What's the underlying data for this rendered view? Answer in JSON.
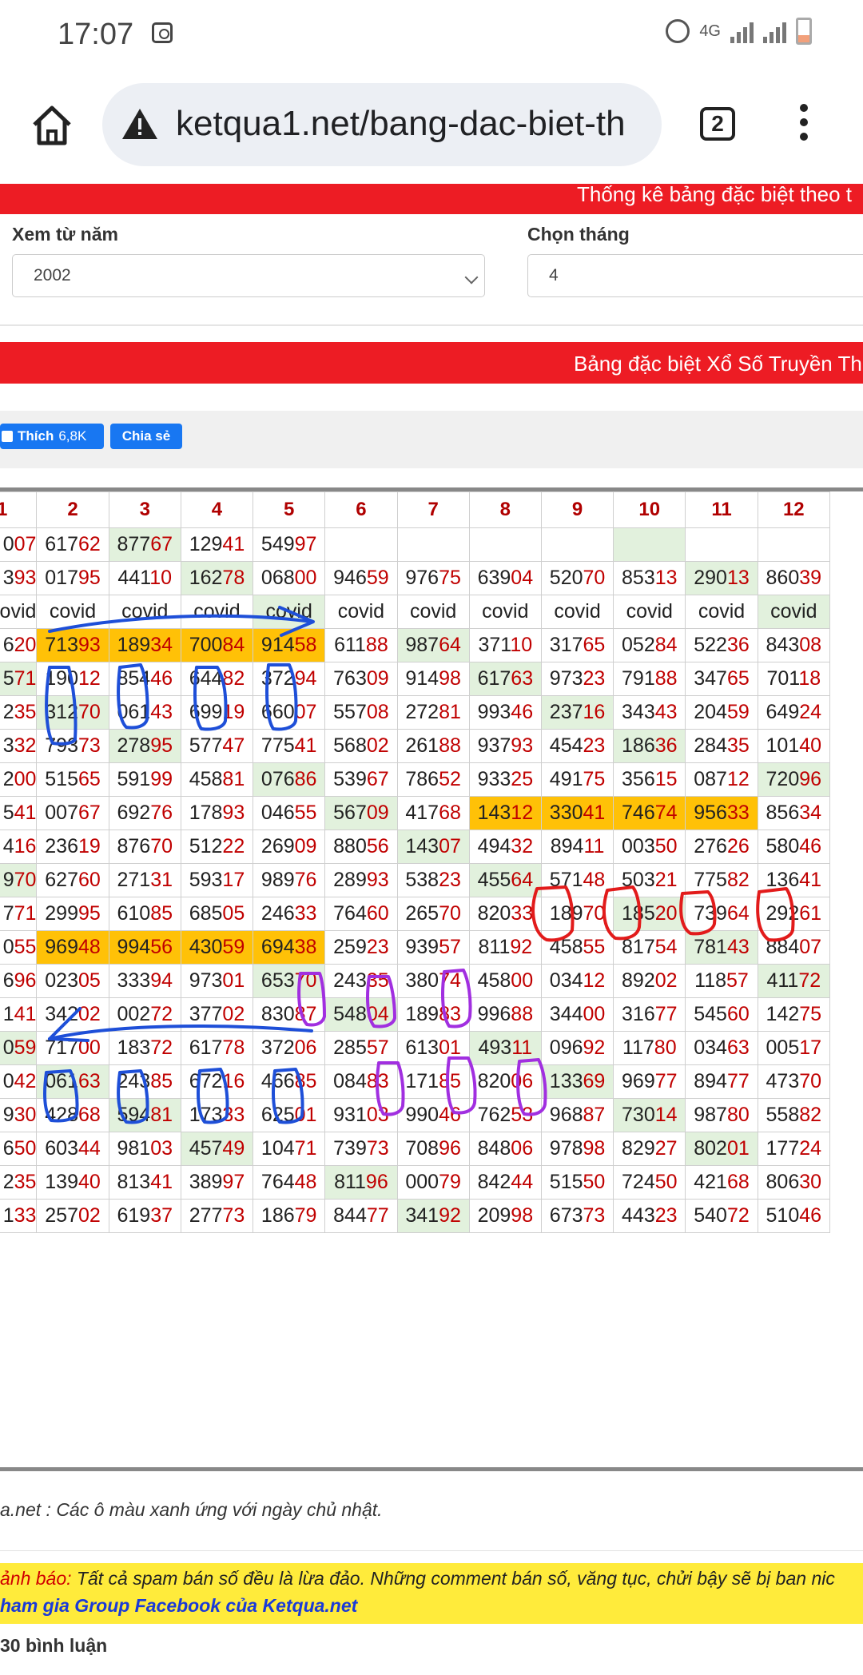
{
  "status": {
    "time": "17:07",
    "network": "4G"
  },
  "browser": {
    "url": "ketqua1.net/bang-dac-biet-th",
    "tab_count": "2"
  },
  "banner_top": "Thống kê bảng đặc biệt theo t",
  "filters": {
    "year_label": "Xem từ năm",
    "year_value": "2002",
    "month_label": "Chọn tháng",
    "month_value": "4"
  },
  "banner_table": "Bảng đặc biệt Xổ Số Truyền Th",
  "social": {
    "like_label": "Thích",
    "like_count": "6,8K",
    "share_label": "Chia sẻ"
  },
  "table": {
    "columns": [
      "1",
      "2",
      "3",
      "4",
      "5",
      "6",
      "7",
      "8",
      "9",
      "10",
      "11",
      "12"
    ],
    "rows": [
      [
        "007",
        "61762",
        "87767",
        "12941",
        "54997",
        "",
        "",
        "",
        "",
        "",
        "",
        ""
      ],
      [
        "393",
        "01795",
        "44110",
        "16278",
        "06800",
        "94659",
        "97675",
        "63904",
        "52070",
        "85313",
        "29013",
        "86039"
      ],
      [
        "ovid",
        "covid",
        "covid",
        "covid",
        "covid",
        "covid",
        "covid",
        "covid",
        "covid",
        "covid",
        "covid",
        "covid"
      ],
      [
        "620",
        "71393",
        "18934",
        "70084",
        "91458",
        "61188",
        "98764",
        "37110",
        "31765",
        "05284",
        "52236",
        "84308"
      ],
      [
        "571",
        "19012",
        "85446",
        "64482",
        "37294",
        "76309",
        "91498",
        "61763",
        "97323",
        "79188",
        "34765",
        "70118"
      ],
      [
        "235",
        "31270",
        "06143",
        "69919",
        "66007",
        "55708",
        "27281",
        "99346",
        "23716",
        "34343",
        "20459",
        "64924"
      ],
      [
        "332",
        "79373",
        "27895",
        "57747",
        "77541",
        "56802",
        "26188",
        "93793",
        "45423",
        "18636",
        "28435",
        "10140"
      ],
      [
        "200",
        "51565",
        "59199",
        "45881",
        "07686",
        "53967",
        "78652",
        "93325",
        "49175",
        "35615",
        "08712",
        "72096"
      ],
      [
        "541",
        "00767",
        "69276",
        "17893",
        "04655",
        "56709",
        "41768",
        "14312",
        "33041",
        "74674",
        "95633",
        "85634"
      ],
      [
        "416",
        "23619",
        "87670",
        "51222",
        "26909",
        "88056",
        "14307",
        "49432",
        "89411",
        "00350",
        "27626",
        "58046"
      ],
      [
        "970",
        "62760",
        "27131",
        "59317",
        "98976",
        "28993",
        "53823",
        "45564",
        "57148",
        "50321",
        "77582",
        "13641"
      ],
      [
        "771",
        "29995",
        "61085",
        "68505",
        "24633",
        "76460",
        "26570",
        "82033",
        "18970",
        "18520",
        "73964",
        "29261"
      ],
      [
        "055",
        "96948",
        "99456",
        "43059",
        "69438",
        "25923",
        "93957",
        "81192",
        "45855",
        "81754",
        "78143",
        "88407"
      ],
      [
        "696",
        "02305",
        "33394",
        "97301",
        "65370",
        "24335",
        "38074",
        "45800",
        "03412",
        "89202",
        "11857",
        "41172"
      ],
      [
        "141",
        "34202",
        "00272",
        "37702",
        "83087",
        "54804",
        "18983",
        "99688",
        "34400",
        "31677",
        "54560",
        "14275"
      ],
      [
        "059",
        "71700",
        "18372",
        "61778",
        "37206",
        "28557",
        "61301",
        "49311",
        "09692",
        "11780",
        "03463",
        "00517"
      ],
      [
        "042",
        "06163",
        "24385",
        "67216",
        "46685",
        "08483",
        "17185",
        "82006",
        "13369",
        "96977",
        "89477",
        "47370"
      ],
      [
        "930",
        "42868",
        "59481",
        "17333",
        "62501",
        "93103",
        "99046",
        "76253",
        "96887",
        "73014",
        "98780",
        "55882"
      ],
      [
        "650",
        "60344",
        "98103",
        "45749",
        "10471",
        "73973",
        "70896",
        "84806",
        "97898",
        "82927",
        "80201",
        "17724"
      ],
      [
        "235",
        "13940",
        "81341",
        "38997",
        "76448",
        "81196",
        "00079",
        "84244",
        "51550",
        "72450",
        "42168",
        "80630"
      ],
      [
        "133",
        "25702",
        "61937",
        "27773",
        "18679",
        "84477",
        "34192",
        "20998",
        "67373",
        "44323",
        "54072",
        "51046"
      ]
    ]
  },
  "note": "a.net : Các ô màu xanh ứng với ngày chủ nhật.",
  "warning": {
    "prefix": "ảnh báo:",
    "text": " Tất cả spam bán số đều là lừa đảo. Những comment bán số, văng tục, chửi bậy sẽ bị ban nic",
    "link": "ham gia Group Facebook của Ketqua.net"
  },
  "comments": "30 bình luận"
}
